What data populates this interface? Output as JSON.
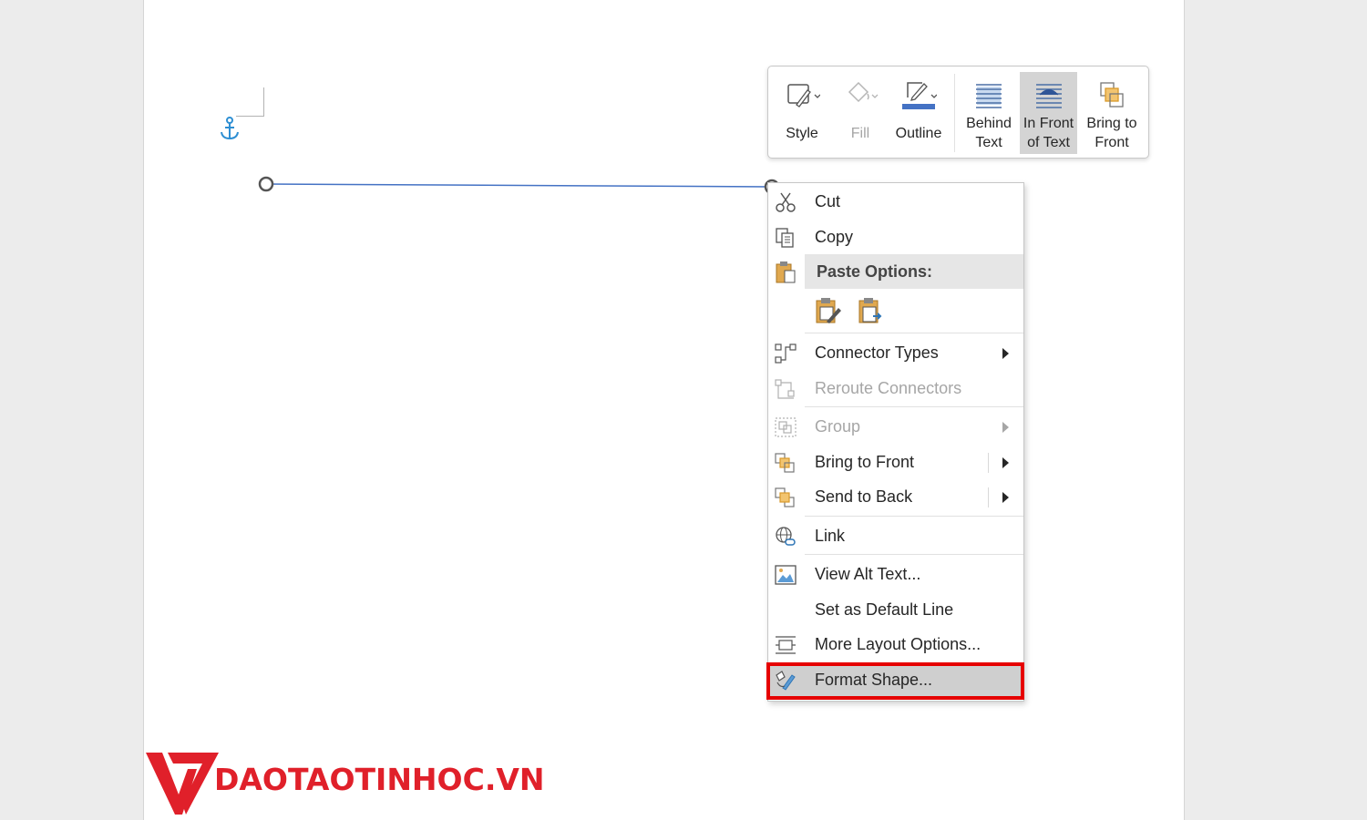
{
  "mini_toolbar": {
    "style_label": "Style",
    "fill_label": "Fill",
    "outline_label": "Outline",
    "behind_text_line1": "Behind",
    "behind_text_line2": "Text",
    "in_front_line1": "In Front",
    "in_front_line2": "of Text",
    "bring_front_line1": "Bring to",
    "bring_front_line2": "Front",
    "outline_color": "#4472c4"
  },
  "context_menu": {
    "cut": "Cut",
    "copy": "Copy",
    "paste_options": "Paste Options:",
    "connector_types": "Connector Types",
    "reroute_connectors": "Reroute Connectors",
    "group": "Group",
    "bring_to_front": "Bring to Front",
    "send_to_back": "Send to Back",
    "link": "Link",
    "view_alt_text": "View Alt Text...",
    "set_default_line": "Set as Default Line",
    "more_layout_options": "More Layout Options...",
    "format_shape": "Format Shape..."
  },
  "logo": {
    "text": "DAOTAOTINHOC.VN",
    "brand_color": "#e0202a"
  },
  "colors": {
    "highlight_border": "#e60000",
    "line_color": "#4472c4"
  }
}
